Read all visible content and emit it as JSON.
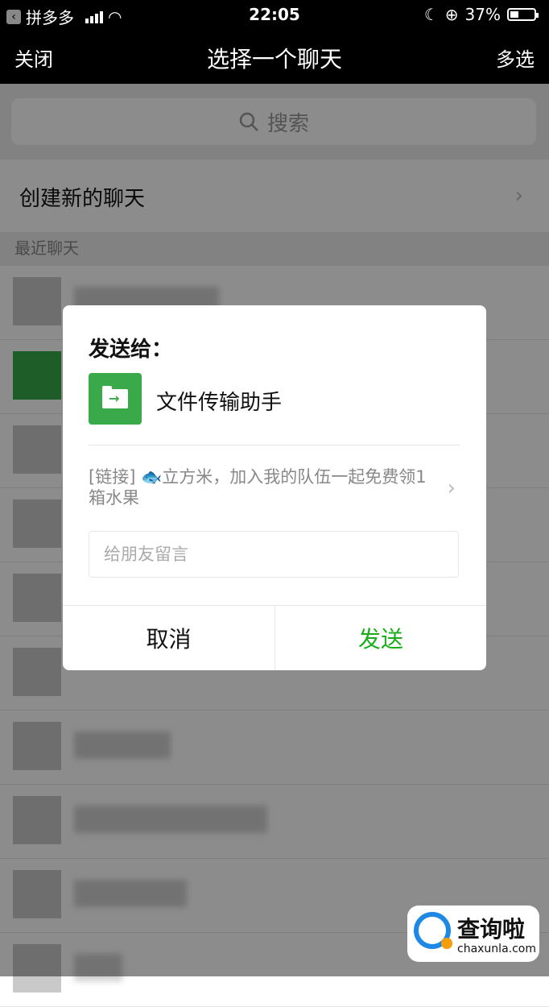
{
  "status_bar": {
    "carrier": "拼多多",
    "time": "22:05",
    "battery": "37%",
    "battery_level": 0.37
  },
  "nav": {
    "close": "关闭",
    "title": "选择一个聊天",
    "multi_select": "多选"
  },
  "search": {
    "placeholder": "搜索"
  },
  "new_chat": {
    "label": "创建新的聊天"
  },
  "recent": {
    "section_title": "最近聊天"
  },
  "dialog": {
    "send_to": "发送给：",
    "target_name": "文件传输助手",
    "message": "[链接] 🐟立方米，加入我的队伍一起免费领1箱水果",
    "input_placeholder": "给朋友留言",
    "cancel": "取消",
    "send": "发送"
  },
  "watermark": {
    "name": "查询啦",
    "domain": "chaxunla.com"
  },
  "colors": {
    "wechat_green": "#1aad19",
    "folder_green": "#3aa94a"
  }
}
